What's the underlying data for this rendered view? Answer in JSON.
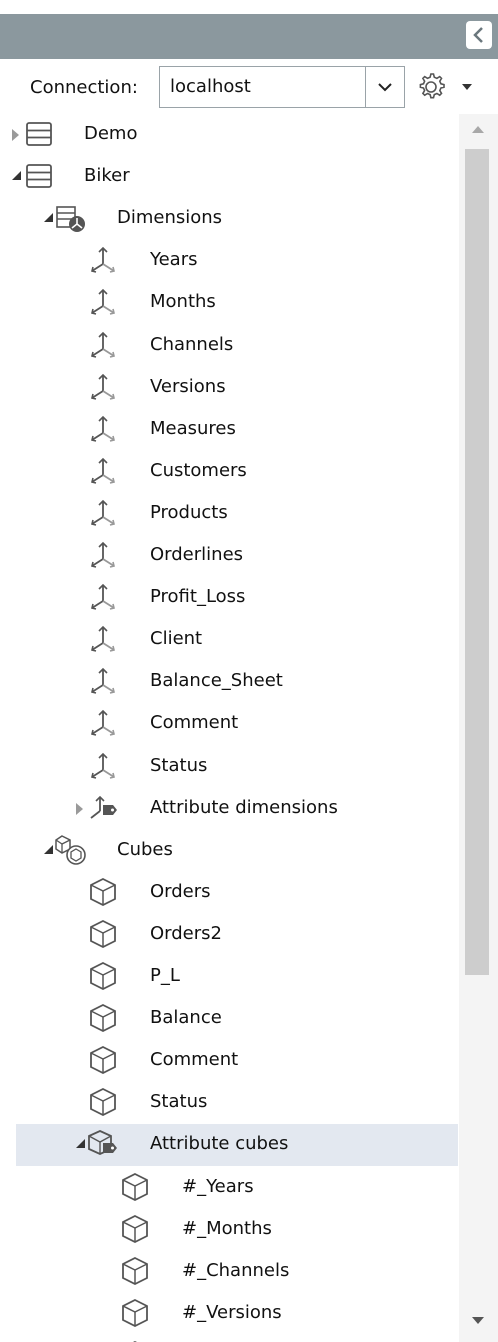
{
  "connection": {
    "label": "Connection:",
    "value": "localhost"
  },
  "tree": [
    {
      "label": "Demo",
      "icon": "database-icon",
      "level": 0,
      "expander": "closed"
    },
    {
      "label": "Biker",
      "icon": "database-icon",
      "level": 0,
      "expander": "open"
    },
    {
      "label": "Dimensions",
      "icon": "dimensions-folder-icon",
      "level": 1,
      "expander": "open"
    },
    {
      "label": "Years",
      "icon": "dimension-icon",
      "level": 2,
      "expander": "none"
    },
    {
      "label": "Months",
      "icon": "dimension-icon",
      "level": 2,
      "expander": "none"
    },
    {
      "label": "Channels",
      "icon": "dimension-icon",
      "level": 2,
      "expander": "none"
    },
    {
      "label": "Versions",
      "icon": "dimension-icon",
      "level": 2,
      "expander": "none"
    },
    {
      "label": "Measures",
      "icon": "dimension-icon",
      "level": 2,
      "expander": "none"
    },
    {
      "label": "Customers",
      "icon": "dimension-icon",
      "level": 2,
      "expander": "none"
    },
    {
      "label": "Products",
      "icon": "dimension-icon",
      "level": 2,
      "expander": "none"
    },
    {
      "label": "Orderlines",
      "icon": "dimension-icon",
      "level": 2,
      "expander": "none"
    },
    {
      "label": "Profit_Loss",
      "icon": "dimension-icon",
      "level": 2,
      "expander": "none"
    },
    {
      "label": "Client",
      "icon": "dimension-icon",
      "level": 2,
      "expander": "none"
    },
    {
      "label": "Balance_Sheet",
      "icon": "dimension-icon",
      "level": 2,
      "expander": "none"
    },
    {
      "label": "Comment",
      "icon": "dimension-icon",
      "level": 2,
      "expander": "none"
    },
    {
      "label": "Status",
      "icon": "dimension-icon",
      "level": 2,
      "expander": "none"
    },
    {
      "label": "Attribute dimensions",
      "icon": "attribute-dimensions-icon",
      "level": 2,
      "expander": "closed"
    },
    {
      "label": "Cubes",
      "icon": "cubes-folder-icon",
      "level": 1,
      "expander": "open"
    },
    {
      "label": "Orders",
      "icon": "cube-icon",
      "level": 2,
      "expander": "none"
    },
    {
      "label": "Orders2",
      "icon": "cube-icon",
      "level": 2,
      "expander": "none"
    },
    {
      "label": "P_L",
      "icon": "cube-icon",
      "level": 2,
      "expander": "none"
    },
    {
      "label": "Balance",
      "icon": "cube-icon",
      "level": 2,
      "expander": "none"
    },
    {
      "label": "Comment",
      "icon": "cube-icon",
      "level": 2,
      "expander": "none"
    },
    {
      "label": "Status",
      "icon": "cube-icon",
      "level": 2,
      "expander": "none"
    },
    {
      "label": "Attribute cubes",
      "icon": "attribute-cubes-icon",
      "level": 2,
      "expander": "open",
      "selected": true
    },
    {
      "label": "#_Years",
      "icon": "cube-icon",
      "level": 3,
      "expander": "none"
    },
    {
      "label": "#_Months",
      "icon": "cube-icon",
      "level": 3,
      "expander": "none"
    },
    {
      "label": "#_Channels",
      "icon": "cube-icon",
      "level": 3,
      "expander": "none"
    },
    {
      "label": "#_Versions",
      "icon": "cube-icon",
      "level": 3,
      "expander": "none"
    },
    {
      "label": "",
      "icon": "cube-icon",
      "level": 3,
      "expander": "none"
    }
  ]
}
